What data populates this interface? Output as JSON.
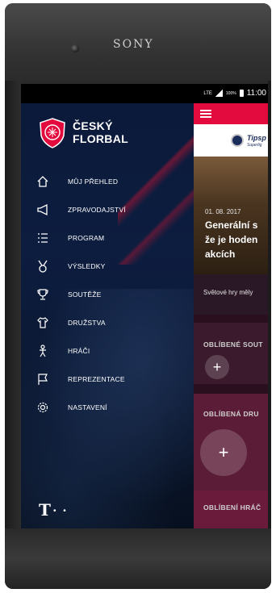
{
  "device": {
    "brand": "SONY"
  },
  "statusbar": {
    "network": "LTE",
    "battery": "100%",
    "time": "11:00"
  },
  "drawer": {
    "logo_text_line1": "ČESKÝ",
    "logo_text_line2": "FLORBAL",
    "items": [
      {
        "label": "MŮJ PŘEHLED",
        "icon": "home-icon"
      },
      {
        "label": "ZPRAVODAJSTVÍ",
        "icon": "megaphone-icon"
      },
      {
        "label": "PROGRAM",
        "icon": "list-icon"
      },
      {
        "label": "VÝSLEDKY",
        "icon": "medal-icon"
      },
      {
        "label": "SOUTĚŽE",
        "icon": "trophy-icon"
      },
      {
        "label": "DRUŽSTVA",
        "icon": "jersey-icon"
      },
      {
        "label": "HRÁČI",
        "icon": "player-icon"
      },
      {
        "label": "REPREZENTACE",
        "icon": "flag-icon"
      },
      {
        "label": "NASTAVENÍ",
        "icon": "gear-icon"
      }
    ],
    "footer_logo": "T",
    "footer_dots": "• •"
  },
  "app": {
    "partner": {
      "name": "Tipsp",
      "sub": "Superlig"
    },
    "news": {
      "date": "01. 08. 2017",
      "title": "Generální s\nže je hoden\nakcích",
      "excerpt": "Světové hry měly"
    },
    "sections": [
      {
        "label": "OBLÍBENÉ SOUT"
      },
      {
        "label": "OBLÍBENÁ DRU"
      },
      {
        "label": "OBLÍBENÍ HRÁČ"
      }
    ],
    "add_symbol": "+"
  },
  "colors": {
    "accent": "#e30b3e",
    "drawer_bg": "#0b1a3a"
  }
}
